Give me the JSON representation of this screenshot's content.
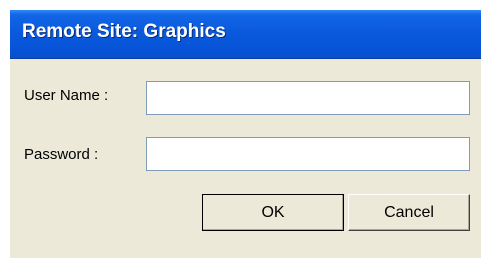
{
  "window": {
    "title": "Remote Site: Graphics"
  },
  "form": {
    "username_label": "User Name :",
    "username_value": "",
    "password_label": "Password :",
    "password_value": ""
  },
  "buttons": {
    "ok_label": "OK",
    "cancel_label": "Cancel"
  },
  "colors": {
    "titlebar": "#0a58dc",
    "dialog_bg": "#ece9d8"
  }
}
